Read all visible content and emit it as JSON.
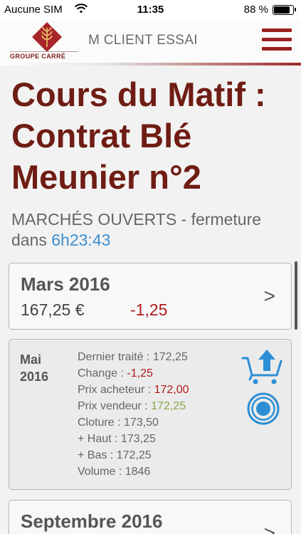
{
  "status_bar": {
    "carrier": "Aucune SIM",
    "time": "11:35",
    "battery_percent": "88 %"
  },
  "header": {
    "brand": "GROUPE CARRÉ",
    "client_name": "M CLIENT ESSAI",
    "brand_color": "#9d2020"
  },
  "page": {
    "title": "Cours du Matif : Contrat Blé Meunier n°2",
    "status_text": "MARCHÉS OUVERTS - fermeture dans ",
    "countdown": "6h23:43",
    "countdown_color": "#3d8fd1"
  },
  "contracts": [
    {
      "month": "Mars 2016",
      "price": "167,25 €",
      "change": "-1,25",
      "chevron": ">"
    },
    {
      "month_line1": "Mai",
      "month_line2": "2016",
      "details": {
        "dernier_traite_label": "Dernier traité : ",
        "dernier_traite": "172,25",
        "change_label": "Change : ",
        "change": "-1,25",
        "prix_acheteur_label": "Prix acheteur : ",
        "prix_acheteur": "172,00",
        "prix_vendeur_label": "Prix vendeur : ",
        "prix_vendeur": "172,25",
        "cloture_label": "Cloture : ",
        "cloture": "173,50",
        "haut_label": "+ Haut : ",
        "haut": "173,25",
        "bas_label": "+ Bas : ",
        "bas": "172,25",
        "volume_label": "Volume : ",
        "volume": "1846"
      },
      "icons": [
        "cart-upload-icon",
        "target-icon"
      ]
    },
    {
      "month": "Septembre 2016",
      "chevron": ">"
    }
  ]
}
